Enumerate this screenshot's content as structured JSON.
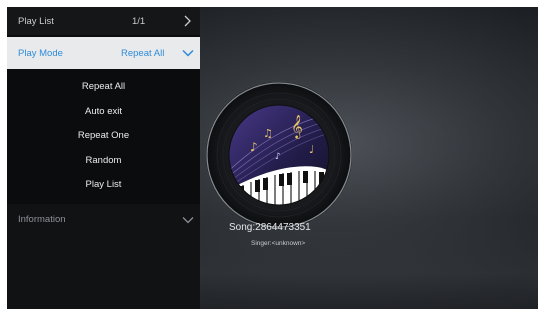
{
  "playlist": {
    "label": "Play List",
    "count": "1/1"
  },
  "play_mode": {
    "label": "Play Mode",
    "value": "Repeat All"
  },
  "mode_options": [
    {
      "label": "Repeat All"
    },
    {
      "label": "Auto exit"
    },
    {
      "label": "Repeat One"
    },
    {
      "label": "Random"
    },
    {
      "label": "Play List"
    }
  ],
  "information": {
    "label": "Information"
  },
  "now_playing": {
    "song": "Song:2864473351",
    "singer": "Singer:<unknown>"
  },
  "colors": {
    "accent": "#2f8bd8",
    "selected_row_bg": "#e9eaec",
    "panel_bg": "#0b0c0e"
  },
  "icons": {
    "playlist_arrow": "chevron-right-icon",
    "mode_dropdown": "chevron-down-icon",
    "info_dropdown": "chevron-down-icon",
    "album_art": "music-disc-icon"
  }
}
